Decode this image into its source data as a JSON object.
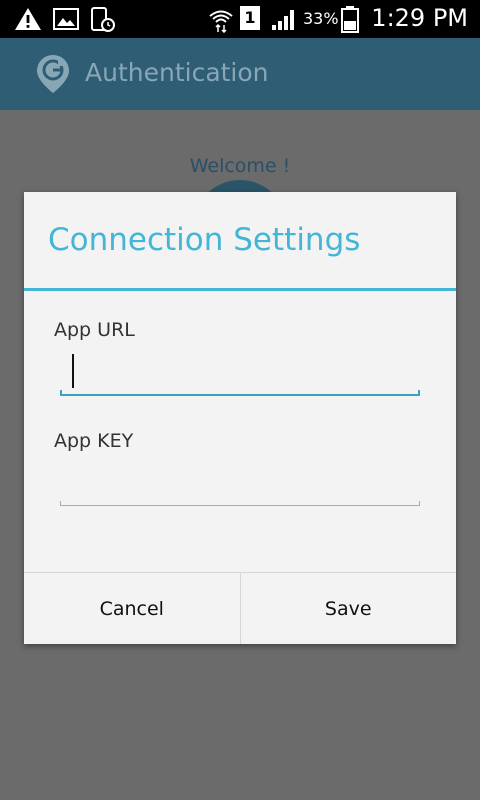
{
  "status_bar": {
    "battery_percent": "33%",
    "time": "1:29 PM",
    "sim_slot": "1",
    "icons": [
      "warning-icon",
      "image-icon",
      "phone-clock-icon",
      "wifi-transfer-icon",
      "sim-icon",
      "signal-icon",
      "battery-icon"
    ]
  },
  "action_bar": {
    "title": "Authentication",
    "logo_letter": "G"
  },
  "background": {
    "welcome_text": "Welcome !"
  },
  "dialog": {
    "title": "Connection Settings",
    "fields": [
      {
        "label": "App URL",
        "value": "",
        "placeholder": ""
      },
      {
        "label": "App KEY",
        "value": "",
        "placeholder": ""
      }
    ],
    "buttons": {
      "cancel": "Cancel",
      "save": "Save"
    }
  },
  "colors": {
    "accent": "#43b6d6",
    "action_bar": "#2e5d74",
    "dim_overlay": "#6b6b6b"
  }
}
